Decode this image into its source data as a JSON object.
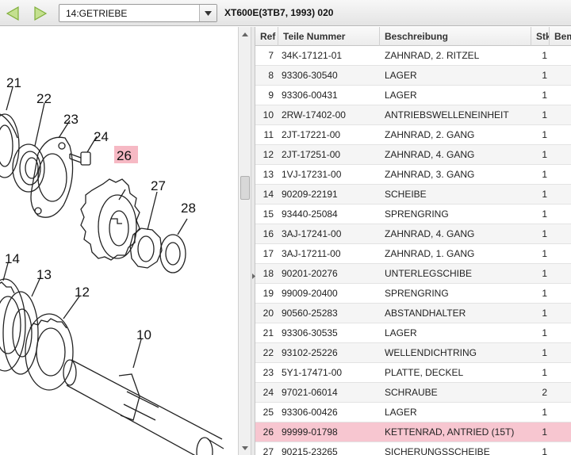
{
  "toolbar": {
    "back_icon": "arrow-left-icon",
    "forward_icon": "arrow-right-icon",
    "group_select_value": "14:GETRIEBE",
    "model_title": "XT600E(3TB7, 1993) 020"
  },
  "colors": {
    "nav_arrow": "#a9d26a",
    "selected_row": "#f7c6d0",
    "callout_highlight": "#f6b9c4"
  },
  "diagram": {
    "callouts": [
      "21",
      "22",
      "23",
      "24",
      "26",
      "27",
      "28",
      "14",
      "13",
      "12",
      "10"
    ],
    "highlighted_callout": "26"
  },
  "table": {
    "headers": {
      "ref": "Ref",
      "part": "Teile Nummer",
      "desc": "Beschreibung",
      "qty": "Stk",
      "note": "Bem"
    },
    "rows": [
      {
        "ref": "7",
        "part": "34K-17121-01",
        "desc": "ZAHNRAD, 2. RITZEL",
        "qty": "1"
      },
      {
        "ref": "8",
        "part": "93306-30540",
        "desc": "LAGER",
        "qty": "1"
      },
      {
        "ref": "9",
        "part": "93306-00431",
        "desc": "LAGER",
        "qty": "1"
      },
      {
        "ref": "10",
        "part": "2RW-17402-00",
        "desc": "ANTRIEBSWELLENEINHEIT",
        "qty": "1"
      },
      {
        "ref": "11",
        "part": "2JT-17221-00",
        "desc": "ZAHNRAD, 2. GANG",
        "qty": "1"
      },
      {
        "ref": "12",
        "part": "2JT-17251-00",
        "desc": "ZAHNRAD, 4. GANG",
        "qty": "1"
      },
      {
        "ref": "13",
        "part": "1VJ-17231-00",
        "desc": "ZAHNRAD, 3. GANG",
        "qty": "1"
      },
      {
        "ref": "14",
        "part": "90209-22191",
        "desc": "SCHEIBE",
        "qty": "1"
      },
      {
        "ref": "15",
        "part": "93440-25084",
        "desc": "SPRENGRING",
        "qty": "1"
      },
      {
        "ref": "16",
        "part": "3AJ-17241-00",
        "desc": "ZAHNRAD, 4. GANG",
        "qty": "1"
      },
      {
        "ref": "17",
        "part": "3AJ-17211-00",
        "desc": "ZAHNRAD, 1. GANG",
        "qty": "1"
      },
      {
        "ref": "18",
        "part": "90201-20276",
        "desc": "UNTERLEGSCHIBE",
        "qty": "1"
      },
      {
        "ref": "19",
        "part": "99009-20400",
        "desc": "SPRENGRING",
        "qty": "1"
      },
      {
        "ref": "20",
        "part": "90560-25283",
        "desc": "ABSTANDHALTER",
        "qty": "1"
      },
      {
        "ref": "21",
        "part": "93306-30535",
        "desc": "LAGER",
        "qty": "1"
      },
      {
        "ref": "22",
        "part": "93102-25226",
        "desc": "WELLENDICHTRING",
        "qty": "1"
      },
      {
        "ref": "23",
        "part": "5Y1-17471-00",
        "desc": "PLATTE, DECKEL",
        "qty": "1"
      },
      {
        "ref": "24",
        "part": "97021-06014",
        "desc": "SCHRAUBE",
        "qty": "2"
      },
      {
        "ref": "25",
        "part": "93306-00426",
        "desc": "LAGER",
        "qty": "1"
      },
      {
        "ref": "26",
        "part": "99999-01798",
        "desc": "KETTENRAD, ANTRIED (15T)",
        "qty": "1",
        "selected": true
      },
      {
        "ref": "27",
        "part": "90215-23265",
        "desc": "SICHERUNGSSCHEIBE",
        "qty": "1"
      }
    ]
  }
}
